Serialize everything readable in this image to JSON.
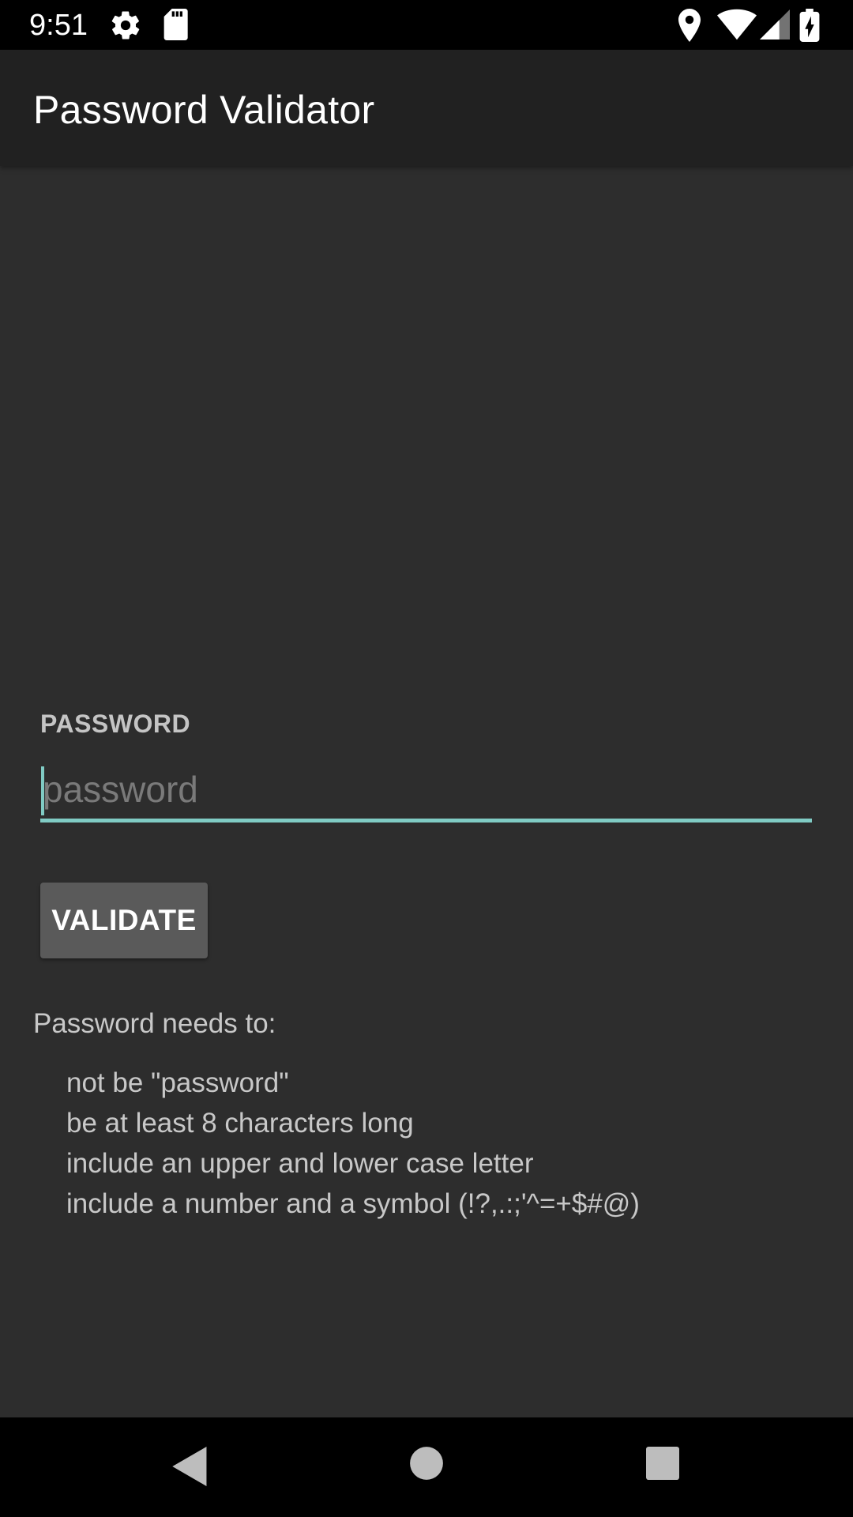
{
  "status_bar": {
    "time": "9:51",
    "icons": [
      "settings-icon",
      "sd-card-icon",
      "location-icon",
      "wifi-icon",
      "signal-icon",
      "battery-charging-icon"
    ]
  },
  "app_bar": {
    "title": "Password Validator"
  },
  "form": {
    "label": "PASSWORD",
    "input_value": "",
    "input_placeholder": "password",
    "validate_label": "VALIDATE"
  },
  "requirements": {
    "title": "Password needs to:",
    "items": [
      "not be \"password\"",
      "be at least 8 characters long",
      "include an upper and lower case letter",
      "include a number and a symbol (!?,.:;'^=+$#@)"
    ]
  },
  "colors": {
    "accent": "#80cbc4",
    "background": "#2d2d2d",
    "app_bar": "#212121",
    "button": "#5a5a5a"
  },
  "nav_bar": {
    "buttons": [
      "back-icon",
      "home-icon",
      "recents-icon"
    ]
  }
}
